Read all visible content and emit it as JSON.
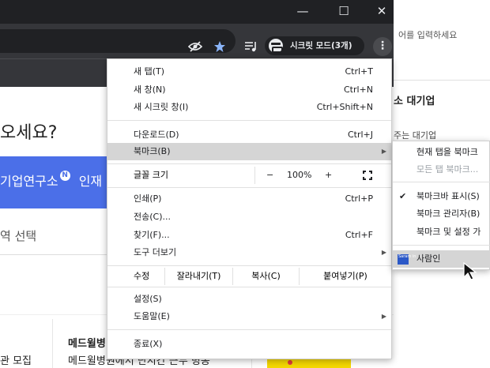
{
  "window": {
    "minimize_glyph": "—",
    "maximize_glyph": "☐",
    "close_glyph": "✕"
  },
  "toolbar": {
    "incognito_label": "시크릿 모드(3개)",
    "menu_glyph": "⋮",
    "icons": [
      "eye-off-icon",
      "star-icon",
      "media-playlist-icon",
      "incognito-icon",
      "kebab-menu-icon"
    ]
  },
  "background_page": {
    "hero_text": "오세요?",
    "banner_text": "기업연구소",
    "banner_badge": "N",
    "banner_text2": "인재",
    "region_select": "역 선택",
    "job1": "관 모집",
    "job2_title": "메드윌병",
    "job2_sub": "메드윌병원에서 단시간 근무 병동"
  },
  "right_window": {
    "search_placeholder": "어를 입력하세요",
    "title": "소 대기업",
    "subtitle": "주는 대기업"
  },
  "menu": {
    "new_tab": {
      "label": "새 탭(T)",
      "shortcut": "Ctrl+T"
    },
    "new_window": {
      "label": "새 창(N)",
      "shortcut": "Ctrl+N"
    },
    "new_incognito": {
      "label": "새 시크릿 창(I)",
      "shortcut": "Ctrl+Shift+N"
    },
    "downloads": {
      "label": "다운로드(D)",
      "shortcut": "Ctrl+J"
    },
    "bookmarks": {
      "label": "북마크(B)"
    },
    "zoom": {
      "label": "글꼴 크기",
      "minus": "−",
      "value": "100%",
      "plus": "+"
    },
    "print": {
      "label": "인쇄(P)",
      "shortcut": "Ctrl+P"
    },
    "cast": {
      "label": "전송(C)..."
    },
    "find": {
      "label": "찾기(F)...",
      "shortcut": "Ctrl+F"
    },
    "more_tools": {
      "label": "도구 더보기"
    },
    "edit": {
      "label": "수정",
      "cut": "잘라내기(T)",
      "copy": "복사(C)",
      "paste": "붙여넣기(P)"
    },
    "settings": {
      "label": "설정(S)"
    },
    "help": {
      "label": "도움말(E)"
    },
    "exit": {
      "label": "종료(X)"
    }
  },
  "bookmarks_submenu": {
    "items": [
      {
        "label": "현재 탭을 북마크",
        "enabled": true
      },
      {
        "label": "모든 탭 북마크...",
        "enabled": false
      },
      {
        "label": "북마크바 표시(S)",
        "checked": true
      },
      {
        "label": "북마크 관리자(B)"
      },
      {
        "label": "북마크 및 설정 가"
      },
      {
        "label": "사람인",
        "favicon_text": "Saram in"
      }
    ]
  },
  "colors": {
    "chrome_dark": "#202124",
    "toolbar": "#35363a",
    "highlight": "#d5d5d5",
    "banner_blue": "#4b6fe8",
    "favicon_blue": "#2b58c7"
  }
}
